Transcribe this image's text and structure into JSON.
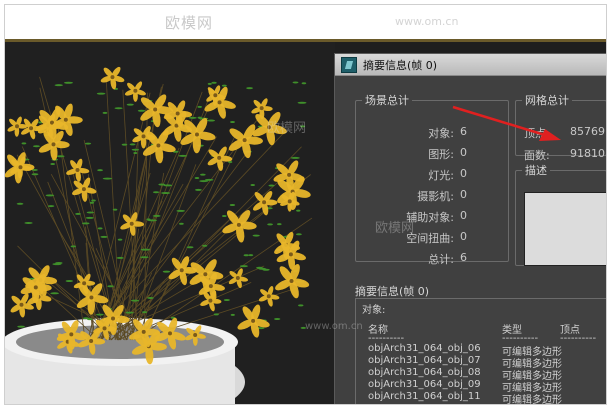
{
  "watermark": {
    "logo_text": "欧模网",
    "url": "www.om.cn"
  },
  "dialog": {
    "title": "摘要信息(帧 0)"
  },
  "scene_totals": {
    "legend": "场景总计",
    "rows": [
      {
        "label": "对象:",
        "value": "6"
      },
      {
        "label": "图形:",
        "value": "0"
      },
      {
        "label": "灯光:",
        "value": "0"
      },
      {
        "label": "摄影机:",
        "value": "0"
      },
      {
        "label": "辅助对象:",
        "value": "0"
      },
      {
        "label": "空间扭曲:",
        "value": "0"
      },
      {
        "label": "总计:",
        "value": "6"
      }
    ]
  },
  "mesh_totals": {
    "legend": "网格总计",
    "rows": [
      {
        "label": "顶点:",
        "value": "85769"
      },
      {
        "label": "面数:",
        "value": "91810"
      }
    ]
  },
  "description": {
    "legend": "描述",
    "text": ""
  },
  "summary": {
    "label": "摘要信息(帧 0)",
    "objects_heading": "对象:",
    "columns": [
      "名称",
      "类型",
      "顶点"
    ],
    "dash": "----------",
    "rows": [
      {
        "name": "objArch31_064_obj_06",
        "type": "可编辑多边形"
      },
      {
        "name": "objArch31_064_obj_07",
        "type": "可编辑多边形"
      },
      {
        "name": "objArch31_064_obj_08",
        "type": "可编辑多边形"
      },
      {
        "name": "objArch31_064_obj_09",
        "type": "可编辑多边形"
      },
      {
        "name": "objArch31_064_obj_11",
        "type": "可编辑多边形"
      }
    ]
  },
  "colors": {
    "arrow": "#e02020",
    "flower": "#e8b62a",
    "leaf": "#3f8f2a"
  }
}
